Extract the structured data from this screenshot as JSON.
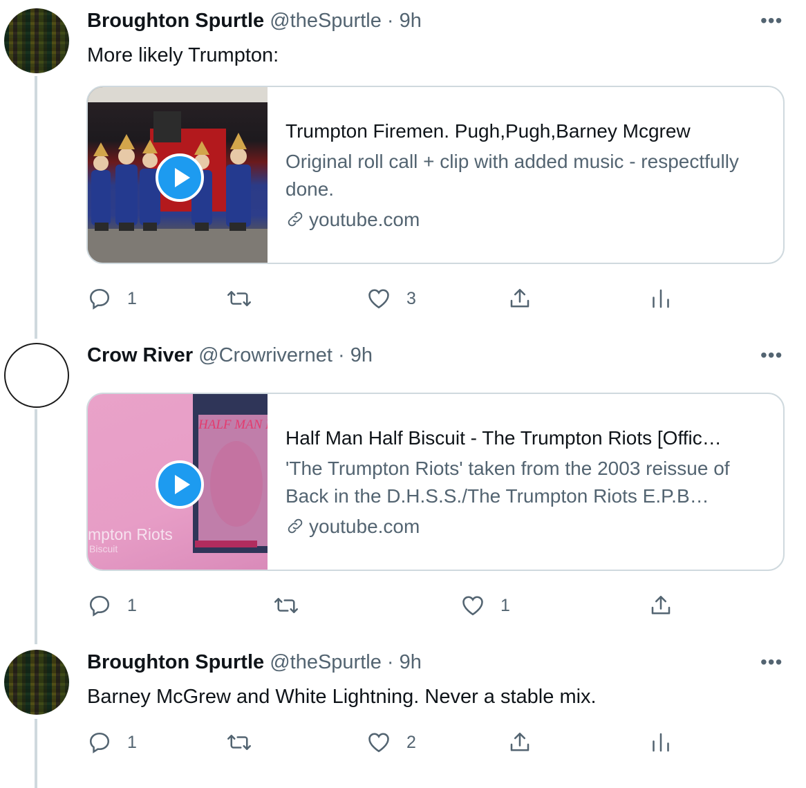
{
  "tweets": [
    {
      "name": "Broughton Spurtle",
      "handle": "@theSpurtle",
      "dot": "·",
      "time": "9h",
      "text": "More likely Trumpton:",
      "card": {
        "title": "Trumpton Firemen. Pugh,Pugh,Barney Mcgrew",
        "description": "Original roll call + clip with added music - respectfully done.",
        "domain": "youtube.com"
      },
      "actions": {
        "replies": "1",
        "likes": "3"
      }
    },
    {
      "name": "Crow River",
      "handle": "@Crowrivernet",
      "dot": "·",
      "time": "9h",
      "card": {
        "title": "Half Man Half Biscuit - The Trumpton Riots [Offic…",
        "description": "'The Trumpton Riots' taken from the 2003 reissue of Back in the D.H.S.S./The Trumpton Riots E.P.B…",
        "domain": "youtube.com",
        "cover_title": "mpton Riots",
        "cover_subtitle": "Biscuit",
        "cover_band": "HALF MAN HA"
      },
      "actions": {
        "replies": "1",
        "likes": "1"
      }
    },
    {
      "name": "Broughton Spurtle",
      "handle": "@theSpurtle",
      "dot": "·",
      "time": "9h",
      "text": "Barney McGrew and White Lightning. Never a stable mix.",
      "actions": {
        "replies": "1",
        "likes": "2"
      }
    }
  ],
  "more_glyph": "•••",
  "colors": {
    "accent": "#1d9bf0",
    "muted": "#536471",
    "border": "#cfd9de"
  }
}
